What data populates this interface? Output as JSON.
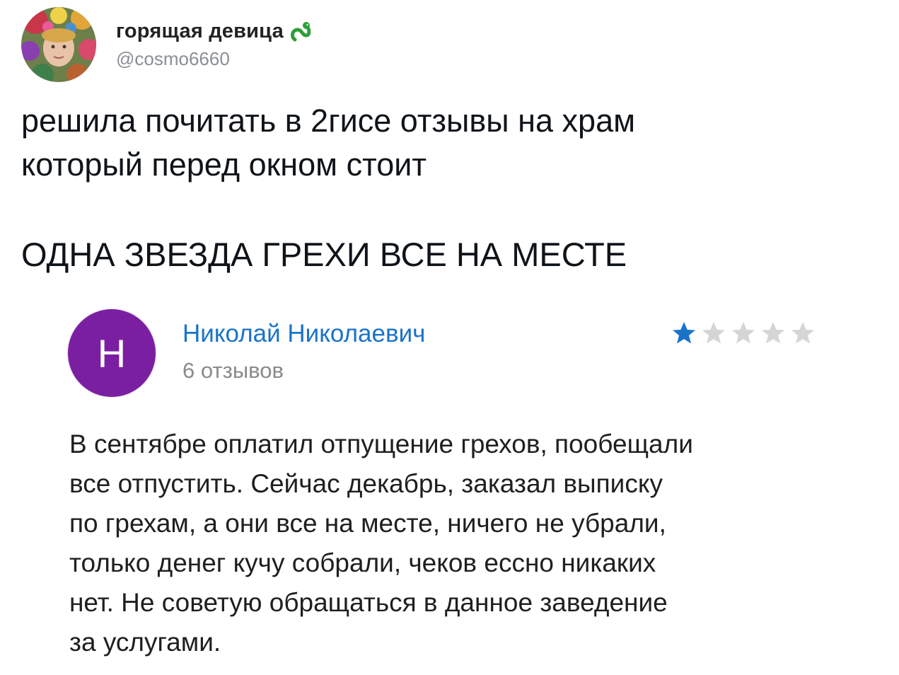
{
  "tweet": {
    "author": {
      "name": "горящая девица",
      "handle": "@cosmo6660",
      "badge_icon": "snake-icon"
    },
    "text_lines": [
      "решила почитать в 2гисе отзывы на храм",
      "который перед окном стоит"
    ],
    "caps_line": "ОДНА ЗВЕЗДА ГРЕХИ ВСЕ НА МЕСТЕ"
  },
  "review": {
    "avatar_letter": "Н",
    "avatar_color": "#7b1fa2",
    "reviewer_name": "Николай Николаевич",
    "reviewer_count": "6 отзывов",
    "rating": 1,
    "rating_max": 5,
    "star_active_color": "#1a73c8",
    "star_inactive_color": "#d5d5d5",
    "body_lines": [
      "В сентябре оплатил отпущение грехов, пообещали",
      "все отпустить. Сейчас декабрь, заказал выписку",
      "по грехам, а они все на месте, ничего не убрали,",
      "только денег кучу собрали, чеков ессно никаких",
      "нет. Не советую обращаться в данное заведение",
      "за услугами."
    ]
  }
}
